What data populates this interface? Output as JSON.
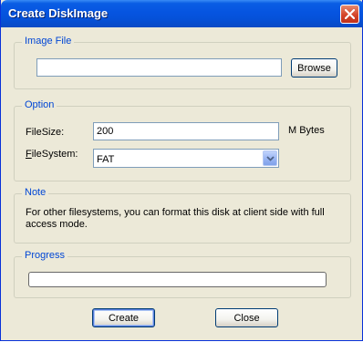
{
  "window": {
    "title": "Create DiskImage",
    "close_icon": "close-icon"
  },
  "image_file": {
    "legend": "Image File",
    "path_value": "",
    "browse_label": "Browse"
  },
  "option": {
    "legend": "Option",
    "filesize_label_prefix": "",
    "filesize_label_u": "",
    "filesize_label": "FileSize:",
    "filesize_value": "200",
    "filesize_unit": "M Bytes",
    "filesystem_label_u": "F",
    "filesystem_label_rest": "ileSystem:",
    "filesystem_selected": "FAT"
  },
  "note": {
    "legend": "Note",
    "text": "For other filesystems, you can format this disk at client side with full access mode."
  },
  "progress": {
    "legend": "Progress",
    "fraction": 0
  },
  "actions": {
    "create_label": "Create",
    "close_label": "Close"
  },
  "colors": {
    "titlebar": "#0654e0",
    "group_legend": "#0046d5",
    "dialog_bg": "#ece9d8"
  }
}
